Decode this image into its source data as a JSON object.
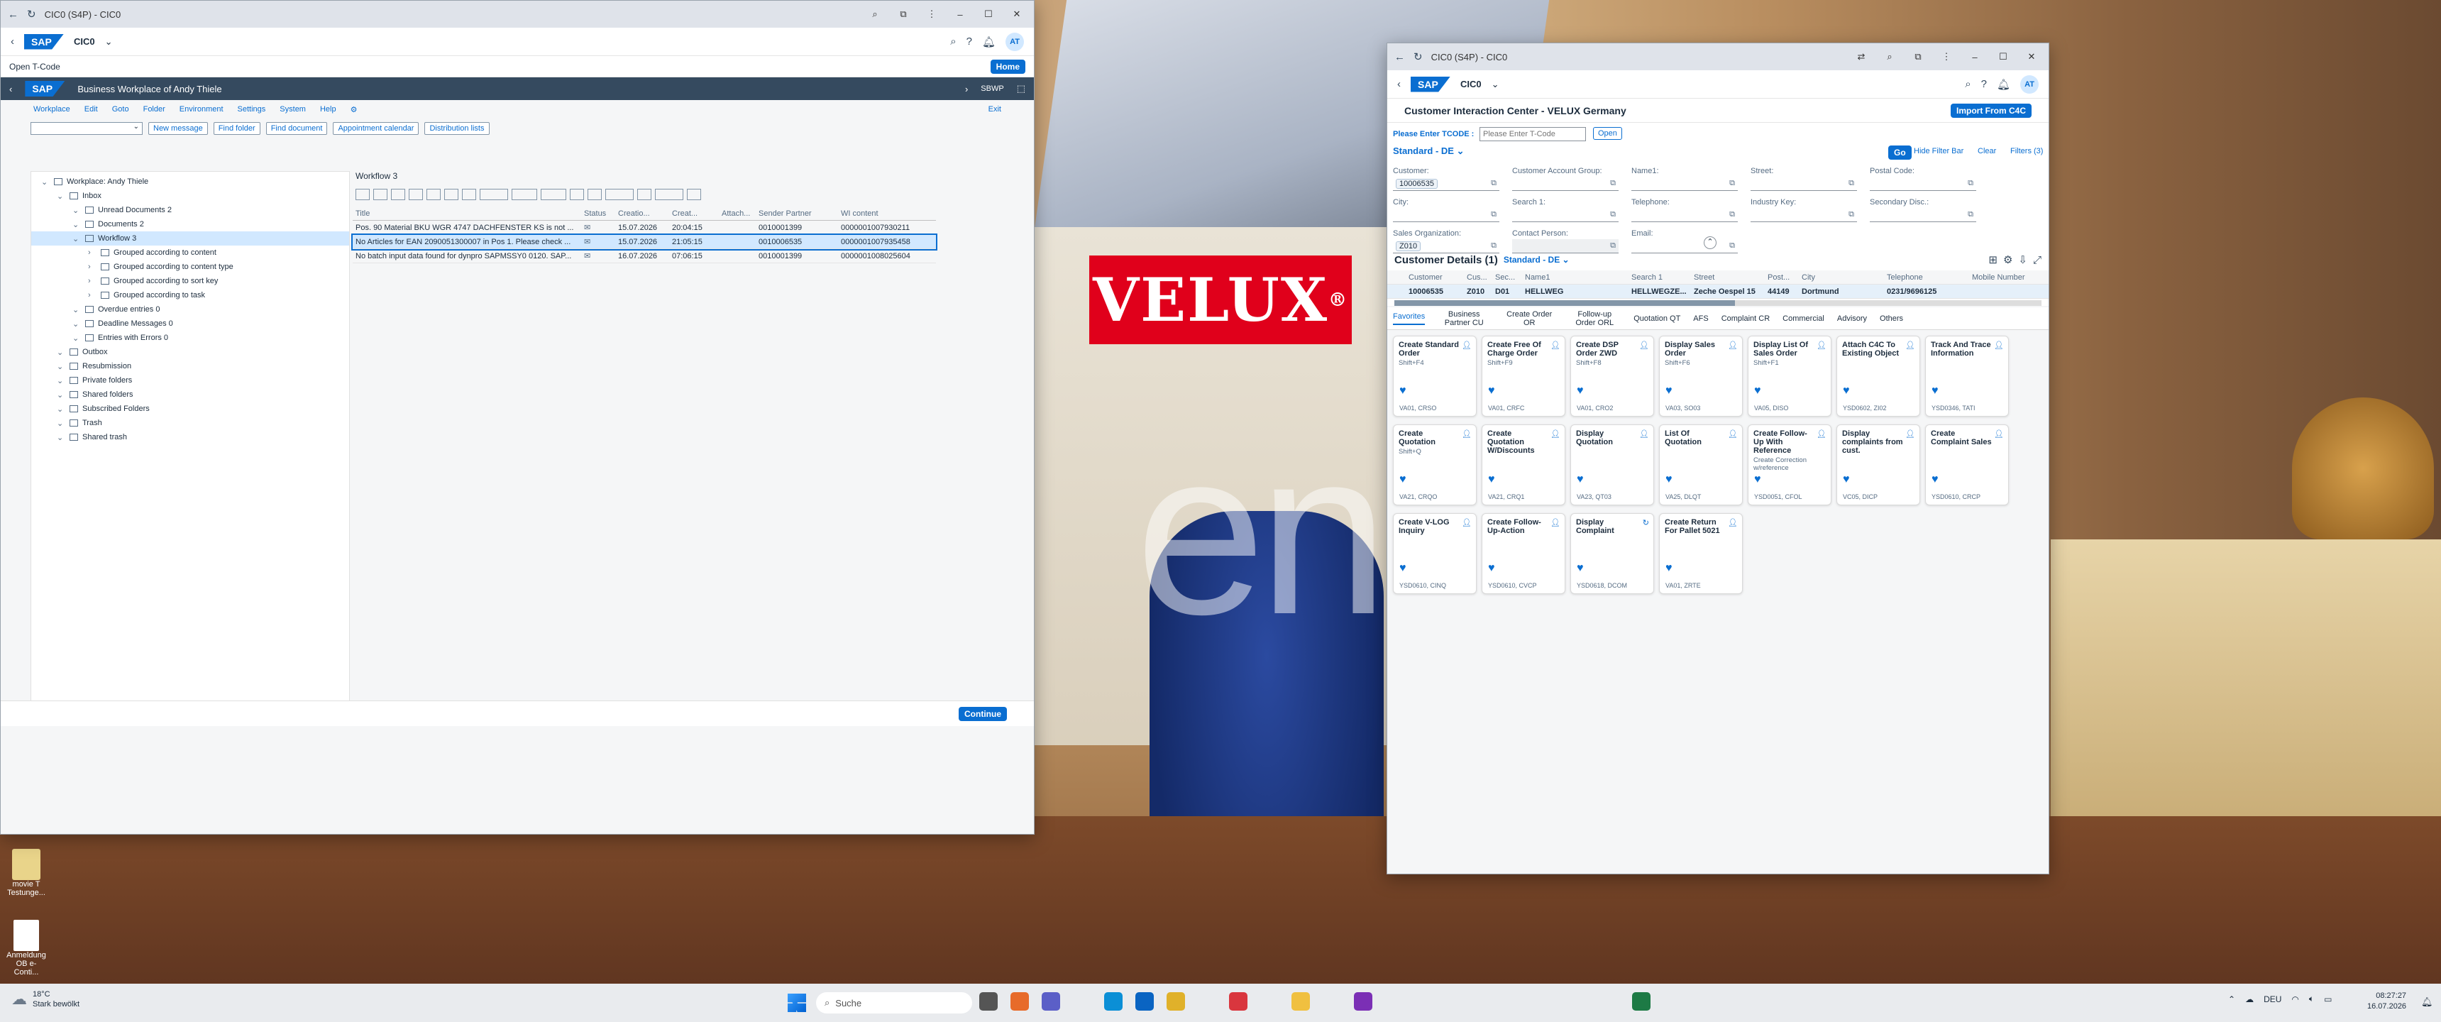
{
  "desktop": {
    "brand": "VELUX",
    "bg_word": "ene",
    "icons": [
      {
        "label": "movie T Testunge..."
      },
      {
        "label": "Anmeldung OB e-Conti..."
      }
    ]
  },
  "left_window": {
    "chrome_title": "CIC0 (S4P) - CIC0",
    "shell_title": "CIC0",
    "avatar": "AT",
    "open_tcode": "Open T-Code",
    "home": "Home",
    "page_title": "Business Workplace of Andy Thiele",
    "sbwp": "SBWP",
    "menu": [
      "Workplace",
      "Edit",
      "Goto",
      "Folder",
      "Environment",
      "Settings",
      "System",
      "Help"
    ],
    "exit": "Exit",
    "toolbar": [
      "New message",
      "Find folder",
      "Find document",
      "Appointment calendar",
      "Distribution lists"
    ],
    "tree": [
      {
        "label": "Workplace: Andy Thiele",
        "level": 0
      },
      {
        "label": "Inbox",
        "level": 1
      },
      {
        "label": "Unread Documents 2",
        "level": 2
      },
      {
        "label": "Documents 2",
        "level": 2
      },
      {
        "label": "Workflow 3",
        "level": 2,
        "selected": true
      },
      {
        "label": "Grouped according to content",
        "level": 3
      },
      {
        "label": "Grouped according to content type",
        "level": 3
      },
      {
        "label": "Grouped according to sort key",
        "level": 3
      },
      {
        "label": "Grouped according to task",
        "level": 3
      },
      {
        "label": "Overdue entries 0",
        "level": 2
      },
      {
        "label": "Deadline Messages 0",
        "level": 2
      },
      {
        "label": "Entries with Errors 0",
        "level": 2
      },
      {
        "label": "Outbox",
        "level": 1
      },
      {
        "label": "Resubmission",
        "level": 1
      },
      {
        "label": "Private folders",
        "level": 1
      },
      {
        "label": "Shared folders",
        "level": 1
      },
      {
        "label": "Subscribed Folders",
        "level": 1
      },
      {
        "label": "Trash",
        "level": 1
      },
      {
        "label": "Shared trash",
        "level": 1
      }
    ],
    "grid_title": "Workflow 3",
    "columns": [
      "Title",
      "Status",
      "Creatio...",
      "Creat...",
      "Attach...",
      "Sender Partner",
      "WI content"
    ],
    "rows": [
      [
        "Pos. 90 Material BKU WGR 4747 DACHFENSTER KS is not ...",
        "",
        "15.07.2026",
        "20:04:15",
        "",
        "0010001399",
        "0000001007930211"
      ],
      [
        "No Articles for EAN 2090051300007 in Pos 1. Please check ...",
        "",
        "15.07.2026",
        "21:05:15",
        "",
        "0010006535",
        "0000001007935458"
      ],
      [
        "No batch input data found for dynpro SAPMSSY0 0120. SAP...",
        "",
        "16.07.2026",
        "07:06:15",
        "",
        "0010001399",
        "0000001008025604"
      ]
    ],
    "continue": "Continue"
  },
  "right_window": {
    "chrome_title": "CIC0 (S4P) - CIC0",
    "shell_title": "CIC0",
    "avatar": "AT",
    "page_title": "Customer Interaction Center - VELUX Germany",
    "import": "Import From C4C",
    "tcode_label": "Please Enter TCODE :",
    "tcode_placeholder": "Please Enter T-Code",
    "open": "Open",
    "variant": "Standard - DE",
    "go": "Go",
    "hide_filter": "Hide Filter Bar",
    "clear": "Clear",
    "filters": "Filters (3)",
    "fields": [
      {
        "label": "Customer:",
        "value": "10006535"
      },
      {
        "label": "Customer Account Group:",
        "value": ""
      },
      {
        "label": "Name1:",
        "value": ""
      },
      {
        "label": "Street:",
        "value": ""
      },
      {
        "label": "Postal Code:",
        "value": ""
      },
      {
        "label": "City:",
        "value": ""
      },
      {
        "label": "Search 1:",
        "value": ""
      },
      {
        "label": "Telephone:",
        "value": ""
      },
      {
        "label": "Industry Key:",
        "value": ""
      },
      {
        "label": "Secondary Disc.:",
        "value": ""
      },
      {
        "label": "Sales Organization:",
        "value": "Z010"
      },
      {
        "label": "Contact Person:",
        "value": ""
      },
      {
        "label": "Email:",
        "value": ""
      }
    ],
    "details_title": "Customer Details (1)",
    "details_variant": "Standard - DE",
    "cols": [
      "Customer",
      "Cus...",
      "Sec...",
      "Name1",
      "Search 1",
      "Street",
      "Post...",
      "City",
      "Telephone",
      "Mobile Number"
    ],
    "row": [
      "10006535",
      "Z010",
      "D01",
      "HELLWEG",
      "HELLWEGZE...",
      "Zeche Oespel 15",
      "44149",
      "Dortmund",
      "0231/9696125",
      ""
    ],
    "tabs": [
      "Favorites",
      "Business Partner CU",
      "Create Order OR",
      "Follow-up Order ORL",
      "Quotation QT",
      "AFS",
      "Complaint CR",
      "Commercial",
      "Advisory",
      "Others"
    ],
    "tiles": [
      {
        "title": "Create Standard Order",
        "sub": "Shift+F4",
        "foot": "VA01, CRSO",
        "icon": "person-icon"
      },
      {
        "title": "Create Free Of Charge Order",
        "sub": "Shift+F9",
        "foot": "VA01, CRFC",
        "icon": "person-icon"
      },
      {
        "title": "Create DSP Order ZWD",
        "sub": "Shift+F8",
        "foot": "VA01, CRO2",
        "icon": "person-icon"
      },
      {
        "title": "Display Sales Order",
        "sub": "Shift+F6",
        "foot": "VA03, SO03",
        "icon": "person-icon"
      },
      {
        "title": "Display List Of Sales Order",
        "sub": "Shift+F1",
        "foot": "VA05, DISO",
        "icon": "person-icon"
      },
      {
        "title": "Attach C4C To Existing Object",
        "sub": "",
        "foot": "YSD0602, ZI02",
        "icon": "person-icon"
      },
      {
        "title": "Track And Trace Information",
        "sub": "",
        "foot": "YSD0346, TATI",
        "icon": "person-icon"
      },
      {
        "title": "Create Quotation",
        "sub": "Shift+Q",
        "foot": "VA21, CRQO",
        "icon": "person-icon"
      },
      {
        "title": "Create Quotation W/Discounts",
        "sub": "",
        "foot": "VA21, CRQ1",
        "icon": "person-icon"
      },
      {
        "title": "Display Quotation",
        "sub": "",
        "foot": "VA23, QT03",
        "icon": "person-icon"
      },
      {
        "title": "List Of Quotation",
        "sub": "",
        "foot": "VA25, DLQT",
        "icon": "person-icon"
      },
      {
        "title": "Create Follow-Up With Reference",
        "sub": "Create Correction w/reference",
        "foot": "YSD0051, CFOL",
        "icon": "person-icon"
      },
      {
        "title": "Display complaints from cust.",
        "sub": "",
        "foot": "VC05, DICP",
        "icon": "person-icon"
      },
      {
        "title": "Create Complaint Sales",
        "sub": "",
        "foot": "YSD0610, CRCP",
        "icon": "person-icon"
      },
      {
        "title": "Create V-LOG Inquiry",
        "sub": "",
        "foot": "YSD0610, CINQ",
        "icon": "person-icon"
      },
      {
        "title": "Create Follow-Up-Action",
        "sub": "",
        "foot": "YSD0610, CVCP",
        "icon": "person-icon"
      },
      {
        "title": "Display Complaint",
        "sub": "",
        "foot": "YSD0618, DCOM",
        "icon": "refresh-icon"
      },
      {
        "title": "Create Return For Pallet 5021",
        "sub": "",
        "foot": "VA01, ZRTE",
        "icon": "person-icon"
      }
    ]
  },
  "taskbar": {
    "weather_temp": "18°C",
    "weather_text": "Stark bewölkt",
    "search": "Suche",
    "lang": "DEU",
    "time": "08:27:27",
    "date": "16.07.2026"
  }
}
